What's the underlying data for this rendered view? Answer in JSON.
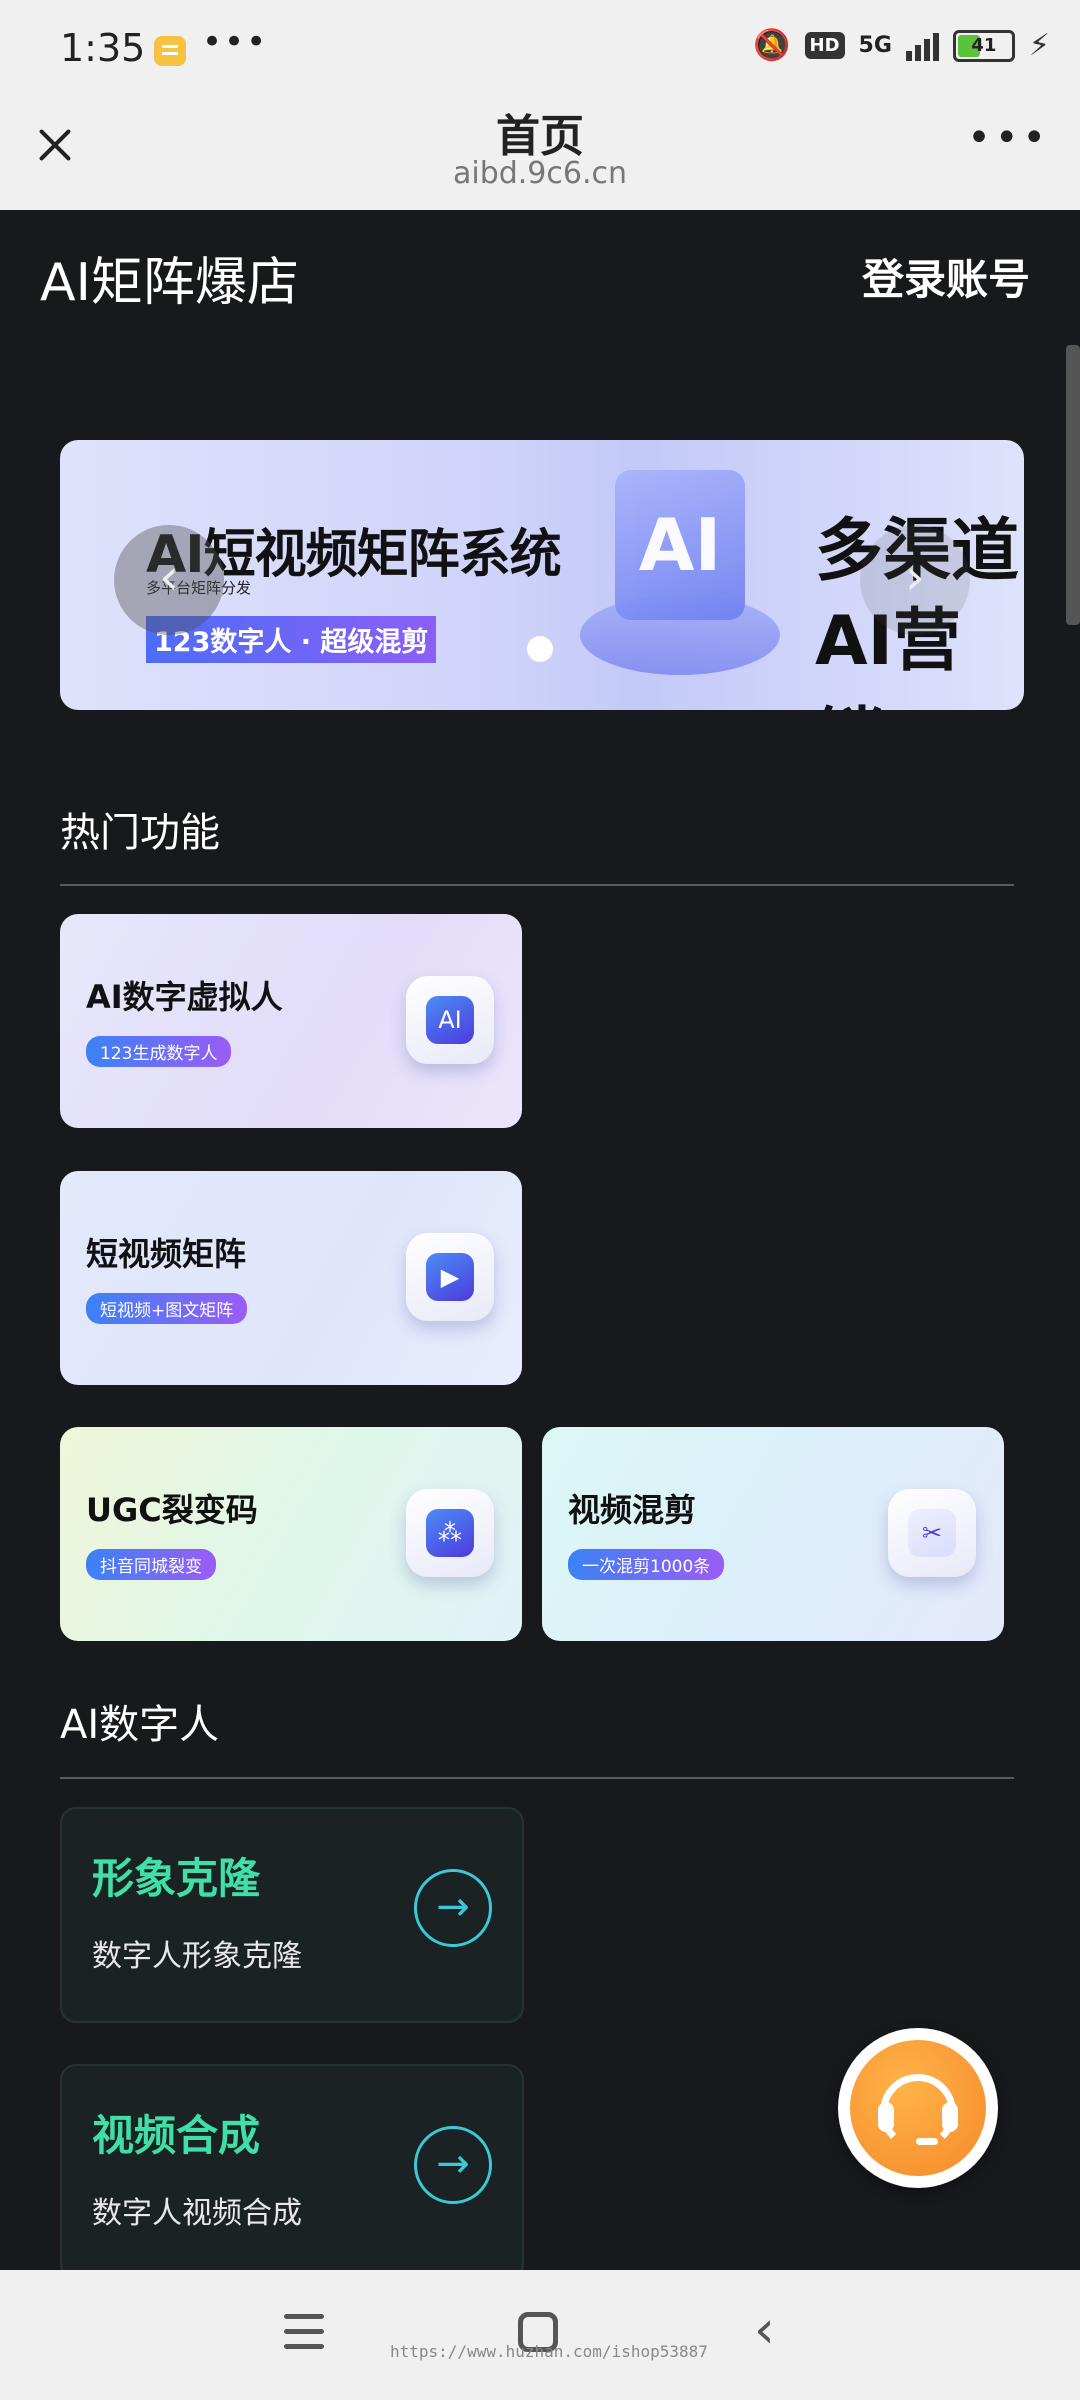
{
  "status_bar": {
    "time": "1:35",
    "more": "•••",
    "hd": "HD",
    "network": "5G",
    "battery": "41",
    "mute_icon": "mute-icon",
    "charging_icon": "charging-icon"
  },
  "nav": {
    "title": "首页",
    "url": "aibd.9c6.cn",
    "more": "•••"
  },
  "header": {
    "brand": "AI矩阵爆店",
    "login": "登录账号"
  },
  "banner": {
    "title": "AI短视频矩阵系统",
    "subtitle": "多平台矩阵分发",
    "tag": "123数字人 · 超级混剪",
    "ai_label": "AI",
    "right_line1": "多渠道",
    "right_line2": "AI营销",
    "prev": "‹",
    "next": "›"
  },
  "hot_section": {
    "title": "热门功能",
    "cards": [
      {
        "title": "AI数字虚拟人",
        "tag": "123生成数字人",
        "icon": "digital-avatar-icon",
        "glyph": "AI"
      },
      {
        "title": "短视频矩阵",
        "tag": "短视频+图文矩阵",
        "icon": "video-play-icon",
        "glyph": "▶"
      },
      {
        "title": "UGC裂变码",
        "tag": "抖音同城裂变",
        "icon": "share-nodes-icon",
        "glyph": "⁂"
      },
      {
        "title": "视频混剪",
        "tag": "一次混剪1000条",
        "icon": "scissors-icon",
        "glyph": "✂"
      }
    ]
  },
  "ai_section": {
    "title": "AI数字人",
    "cards": [
      {
        "title": "形象克隆",
        "desc": "数字人形象克隆",
        "arrow": "→"
      },
      {
        "title": "视频合成",
        "desc": "数字人视频合成",
        "arrow": "→"
      }
    ]
  },
  "support": {
    "icon": "headset-icon"
  },
  "bottom_nav": {
    "watermark": "https://www.huzhan.com/ishop53887",
    "back": "‹"
  }
}
